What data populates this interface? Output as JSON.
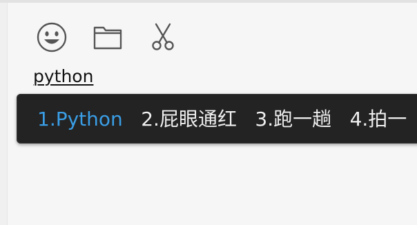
{
  "composition": {
    "text": "python"
  },
  "toolbar": {
    "emoji_icon": "smiley-face-icon",
    "folder_icon": "folder-icon",
    "scissors_icon": "scissors-icon"
  },
  "candidates": [
    {
      "label": "1.Python",
      "selected": true
    },
    {
      "label": "2.屁眼通红",
      "selected": false
    },
    {
      "label": "3.跑一趟",
      "selected": false
    },
    {
      "label": "4.拍一",
      "selected": false
    }
  ],
  "colors": {
    "selected_candidate": "#3a9ee6",
    "candidate_text": "#f0f0f0",
    "candidate_bar_bg": "#232323"
  }
}
